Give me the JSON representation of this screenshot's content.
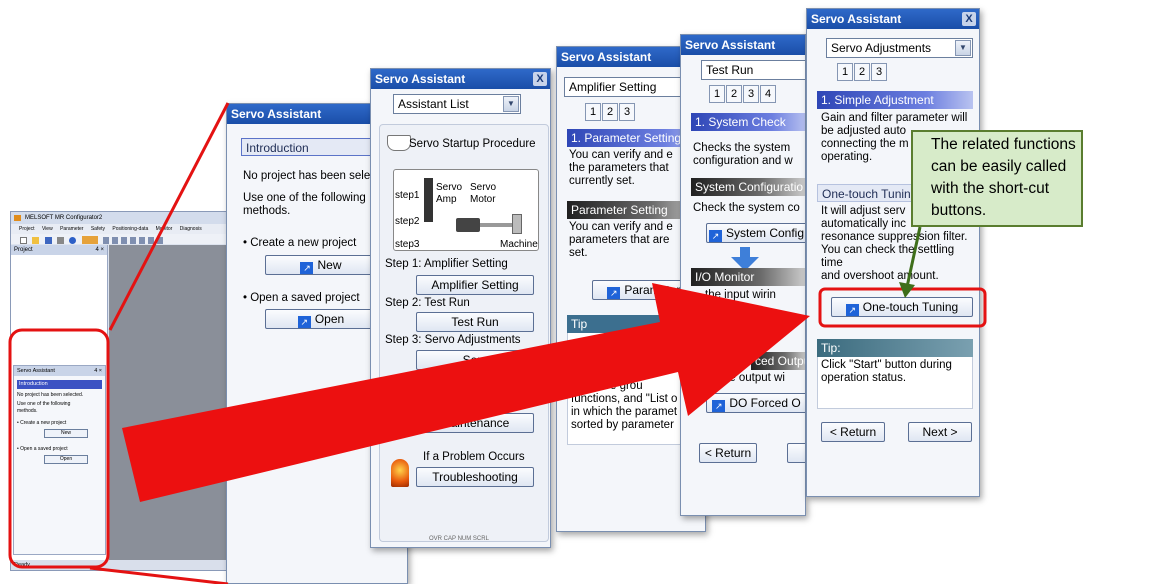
{
  "mini_app": {
    "title": "MELSOFT MR Configurator2",
    "menu": [
      "Project",
      "View",
      "Parameter",
      "Safety",
      "Positioning-data",
      "Monitor",
      "Diagnosis"
    ],
    "project_pane_title": "Project",
    "pane_controls": "4 ×",
    "assistant_title": "Servo Assistant",
    "intro": "Introduction",
    "line1": "No project has been selected.",
    "line2": "Use one of the following methods.",
    "create": "• Create a new project",
    "new": "New",
    "open_saved": "• Open a saved project",
    "open": "Open",
    "status": "Ready"
  },
  "panel1": {
    "title": "Servo Assistant",
    "header": "Introduction",
    "line1": "No project has been sele",
    "line2": "Use one of the following\nmethods.",
    "create": "• Create a new project",
    "new": "New",
    "open_saved": "• Open a saved project",
    "open": "Open"
  },
  "panel2": {
    "title": "Servo Assistant",
    "close": "X",
    "dropdown": "Assistant List",
    "procedure": "Servo Startup Procedure",
    "step1": "step1",
    "step2": "step2",
    "step3": "step3",
    "servo_amp": "Servo\nAmp",
    "servo_motor": "Servo\nMotor",
    "machine": "Machine",
    "s1_label": "Step 1: Amplifier Setting",
    "s1_btn": "Amplifier Setting",
    "s2_label": "Step 2: Test Run",
    "s2_btn": "Test Run",
    "s3_label": "Step 3: Servo Adjustments",
    "s3_btn": "Serv",
    "maint_btn": "Maintenance",
    "problem": "If a Problem Occurs",
    "trouble_btn": "Troubleshooting",
    "status": "OVR CAP NUM SCRL"
  },
  "panel3": {
    "title": "Servo Assistant",
    "dropdown": "Amplifier Setting",
    "tabs": [
      "1",
      "2",
      "3"
    ],
    "head1": "1. Parameter Setting",
    "text1": "You can verify and e\nthe parameters that\ncurrently set.",
    "head2": "Parameter Setting",
    "text2": "You can verify and e\nparameters that are\nset.",
    "btn": "Parameter S",
    "tip": "Tip",
    "tip_text": "eters are grou\nfunctions, and \"List o\nin which the paramet\nsorted by parameter"
  },
  "panel4": {
    "title": "Servo Assistant",
    "dropdown": "Test Run",
    "tabs": [
      "1",
      "2",
      "3",
      "4"
    ],
    "head1": "1. System Check",
    "text1": "Checks the system\nconfiguration and w",
    "head2": "System Configuratio",
    "text2": "Check the system co",
    "btn1": "System Config",
    "head3": "I/O Monitor",
    "text3": "the input wirin",
    "head4": "ced Output",
    "text4": "ck the output wi",
    "btn2": "DO Forced O",
    "return": "< Return"
  },
  "panel5": {
    "title": "Servo Assistant",
    "close": "X",
    "dropdown": "Servo Adjustments",
    "tabs": [
      "1",
      "2",
      "3"
    ],
    "head1": "1. Simple Adjustment",
    "text1": "Gain and filter parameter will\nbe adjusted auto\nconnecting the m\noperating.",
    "head2": "One-touch Tunin",
    "text2": "It will adjust serv\nautomatically inc\nresonance suppression filter.\nYou can check the settling time\nand overshoot amount.",
    "btn": "One-touch Tuning",
    "tip": "Tip:",
    "tip_text": "Click \"Start\" button during\noperation status.",
    "return": "< Return",
    "next": "Next >"
  },
  "callout": {
    "text": "The related functions\ncan be easily called\nwith the short-cut\nbuttons."
  },
  "colors": {
    "title_bar": "#1f56b8",
    "highlight_red": "#e41212",
    "callout_bg": "#d7ebc9",
    "callout_border": "#5a7d2f"
  }
}
